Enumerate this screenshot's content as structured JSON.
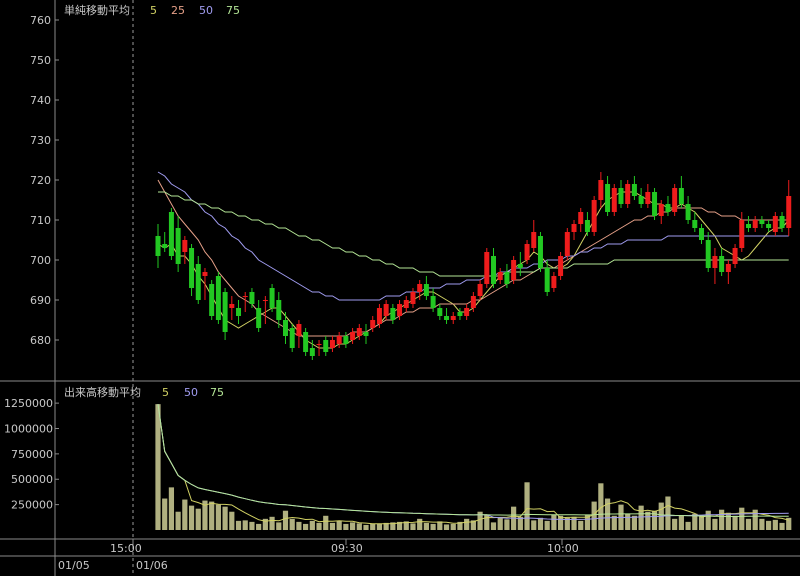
{
  "price_panel": {
    "title": "単純移動平均",
    "ma_labels": [
      {
        "text": "5",
        "color": "#d2d264"
      },
      {
        "text": "25",
        "color": "#e6a088"
      },
      {
        "text": "50",
        "color": "#a09cf0"
      },
      {
        "text": "75",
        "color": "#b4e696"
      }
    ]
  },
  "volume_panel": {
    "title": "出来高移動平均",
    "ma_labels": [
      {
        "text": "5",
        "color": "#d2d264"
      },
      {
        "text": "50",
        "color": "#a09cf0"
      },
      {
        "text": "75",
        "color": "#b4e696"
      }
    ]
  },
  "colors": {
    "up": "#ee1c1c",
    "down": "#22c822",
    "volume": "#b0b080",
    "axis": "#c8c8c8",
    "grid": "#3c3c3c",
    "background": "#000000"
  },
  "chart_data": [
    {
      "type": "candlestick",
      "title": "単純移動平均",
      "ylim": [
        672,
        764
      ],
      "yticks": [
        680,
        690,
        700,
        710,
        720,
        730,
        740,
        750,
        760
      ],
      "ytick_labels": [
        "680",
        "690",
        "700",
        "710",
        "720",
        "730",
        "740",
        "750",
        "760"
      ],
      "x_tick_labels": [
        "15:00",
        "09:30",
        "10:00"
      ],
      "date_labels": [
        "01/05",
        "01/06"
      ],
      "candles_ohlc": [
        [
          706,
          709,
          698,
          701
        ],
        [
          704,
          707,
          702,
          703
        ],
        [
          712,
          713,
          700,
          701
        ],
        [
          708,
          711,
          697,
          699
        ],
        [
          702,
          706,
          699,
          705
        ],
        [
          703,
          704,
          691,
          693
        ],
        [
          699,
          701,
          689,
          690
        ],
        [
          696,
          698,
          690,
          697
        ],
        [
          694,
          695,
          685,
          686
        ],
        [
          696,
          697,
          684,
          685
        ],
        [
          692,
          693,
          680,
          682
        ],
        [
          688,
          691,
          685,
          689
        ],
        [
          688,
          690,
          684,
          686
        ],
        [
          691,
          692,
          687,
          691
        ],
        [
          692,
          693,
          688,
          689
        ],
        [
          688,
          690,
          682,
          683
        ],
        [
          690,
          691,
          684,
          690
        ],
        [
          693,
          694,
          687,
          688
        ],
        [
          690,
          692,
          683,
          685
        ],
        [
          685,
          687,
          679,
          681
        ],
        [
          683,
          684,
          677,
          678
        ],
        [
          681,
          685,
          678,
          684
        ],
        [
          682,
          683,
          676,
          677
        ],
        [
          678,
          680,
          675,
          676
        ],
        [
          679,
          680,
          676,
          679
        ],
        [
          680,
          681,
          676,
          677
        ],
        [
          678,
          681,
          677,
          680
        ],
        [
          679,
          682,
          678,
          681
        ],
        [
          681,
          682,
          678,
          679
        ],
        [
          680,
          683,
          679,
          682
        ],
        [
          681,
          684,
          680,
          683
        ],
        [
          682,
          684,
          679,
          681
        ],
        [
          683,
          686,
          682,
          685
        ],
        [
          684,
          689,
          683,
          688
        ],
        [
          686,
          690,
          685,
          689
        ],
        [
          688,
          689,
          684,
          685
        ],
        [
          686,
          690,
          685,
          689
        ],
        [
          688,
          691,
          687,
          690
        ],
        [
          689,
          693,
          688,
          692
        ],
        [
          692,
          695,
          690,
          694
        ],
        [
          694,
          696,
          690,
          691
        ],
        [
          691,
          693,
          687,
          688
        ],
        [
          688,
          689,
          685,
          686
        ],
        [
          686,
          688,
          684,
          685
        ],
        [
          685,
          687,
          684,
          686
        ],
        [
          687,
          688,
          685,
          686
        ],
        [
          686,
          689,
          685,
          688
        ],
        [
          688,
          692,
          687,
          691
        ],
        [
          691,
          695,
          690,
          694
        ],
        [
          694,
          703,
          693,
          702
        ],
        [
          701,
          703,
          693,
          694
        ],
        [
          695,
          698,
          694,
          697
        ],
        [
          697,
          699,
          693,
          694
        ],
        [
          695,
          701,
          694,
          700
        ],
        [
          699,
          702,
          696,
          698
        ],
        [
          700,
          705,
          699,
          704
        ],
        [
          703,
          710,
          702,
          707
        ],
        [
          706,
          707,
          697,
          698
        ],
        [
          698,
          700,
          691,
          692
        ],
        [
          693,
          697,
          692,
          696
        ],
        [
          696,
          702,
          695,
          701
        ],
        [
          701,
          708,
          700,
          707
        ],
        [
          707,
          710,
          705,
          709
        ],
        [
          709,
          713,
          707,
          712
        ],
        [
          710,
          712,
          706,
          707
        ],
        [
          707,
          716,
          706,
          715
        ],
        [
          715,
          722,
          713,
          720
        ],
        [
          719,
          721,
          711,
          712
        ],
        [
          712,
          719,
          711,
          718
        ],
        [
          718,
          720,
          713,
          714
        ],
        [
          714,
          720,
          713,
          719
        ],
        [
          719,
          721,
          715,
          716
        ],
        [
          716,
          718,
          713,
          714
        ],
        [
          714,
          719,
          713,
          717
        ],
        [
          717,
          718,
          710,
          711
        ],
        [
          711,
          715,
          709,
          714
        ],
        [
          714,
          716,
          711,
          712
        ],
        [
          712,
          719,
          711,
          718
        ],
        [
          718,
          721,
          713,
          714
        ],
        [
          714,
          716,
          709,
          710
        ],
        [
          710,
          712,
          707,
          708
        ],
        [
          708,
          709,
          704,
          705
        ],
        [
          705,
          707,
          697,
          698
        ],
        [
          698,
          703,
          694,
          701
        ],
        [
          701,
          703,
          696,
          697
        ],
        [
          697,
          700,
          694,
          699
        ],
        [
          699,
          704,
          698,
          703
        ],
        [
          703,
          712,
          702,
          710
        ],
        [
          709,
          711,
          707,
          708
        ],
        [
          708,
          711,
          707,
          710
        ],
        [
          710,
          711,
          708,
          709
        ],
        [
          709,
          710,
          707,
          708
        ],
        [
          707,
          712,
          706,
          711
        ],
        [
          711,
          712,
          707,
          708
        ],
        [
          708,
          720,
          706,
          716
        ]
      ],
      "series": [
        {
          "name": "5",
          "color": "#d2d264",
          "values": [
            704,
            703,
            704,
            701,
            701,
            699,
            696,
            694,
            691,
            688,
            685,
            684,
            683,
            684,
            685,
            686,
            687,
            688,
            688,
            686,
            684,
            682,
            680,
            679,
            678,
            678,
            678,
            679,
            679,
            680,
            681,
            682,
            683,
            684,
            686,
            687,
            688,
            689,
            690,
            691,
            692,
            692,
            691,
            690,
            689,
            687,
            687,
            688,
            690,
            692,
            694,
            696,
            697,
            698,
            699,
            700,
            702,
            701,
            699,
            698,
            698,
            699,
            701,
            704,
            707,
            710,
            713,
            715,
            716,
            717,
            717,
            717,
            716,
            715,
            714,
            714,
            713,
            713,
            714,
            713,
            712,
            710,
            708,
            706,
            703,
            702,
            701,
            700,
            701,
            703,
            705,
            707,
            708,
            708,
            710
          ]
        },
        {
          "name": "25",
          "color": "#e6a088",
          "values": [
            720,
            717,
            714,
            711,
            709,
            707,
            705,
            702,
            700,
            697,
            695,
            693,
            691,
            690,
            689,
            687,
            686,
            685,
            684,
            683,
            682,
            681,
            681,
            681,
            681,
            681,
            681,
            681,
            681,
            682,
            682,
            682,
            683,
            684,
            685,
            685,
            686,
            687,
            687,
            688,
            688,
            688,
            689,
            689,
            689,
            689,
            689,
            690,
            690,
            691,
            692,
            693,
            694,
            695,
            695,
            696,
            697,
            698,
            698,
            698,
            699,
            700,
            701,
            702,
            703,
            704,
            705,
            706,
            707,
            708,
            709,
            710,
            710,
            711,
            711,
            712,
            712,
            713,
            713,
            713,
            713,
            713,
            712,
            712,
            711,
            711,
            711,
            710,
            710,
            710,
            710,
            710,
            710,
            710,
            710
          ]
        },
        {
          "name": "50",
          "color": "#a09cf0",
          "values": [
            722,
            721,
            719,
            718,
            717,
            715,
            714,
            712,
            711,
            709,
            708,
            706,
            705,
            703,
            702,
            700,
            699,
            698,
            697,
            696,
            695,
            694,
            693,
            692,
            692,
            691,
            691,
            690,
            690,
            690,
            690,
            690,
            690,
            690,
            691,
            691,
            691,
            692,
            692,
            692,
            693,
            693,
            693,
            694,
            694,
            694,
            695,
            695,
            695,
            696,
            696,
            697,
            697,
            698,
            698,
            698,
            699,
            699,
            700,
            700,
            700,
            701,
            701,
            702,
            702,
            703,
            703,
            704,
            704,
            704,
            705,
            705,
            705,
            705,
            705,
            705,
            706,
            706,
            706,
            706,
            706,
            706,
            706,
            706,
            706,
            706,
            706,
            706,
            706,
            706,
            706,
            706,
            706,
            706,
            706
          ]
        },
        {
          "name": "75",
          "color": "#b4e696",
          "values": [
            717,
            717,
            716,
            716,
            715,
            715,
            714,
            714,
            713,
            713,
            712,
            712,
            711,
            711,
            710,
            710,
            709,
            709,
            708,
            708,
            707,
            706,
            706,
            705,
            705,
            704,
            703,
            703,
            702,
            702,
            701,
            701,
            700,
            700,
            699,
            699,
            698,
            698,
            698,
            697,
            697,
            697,
            696,
            696,
            696,
            696,
            696,
            696,
            696,
            696,
            696,
            696,
            697,
            697,
            697,
            697,
            697,
            698,
            698,
            698,
            698,
            698,
            699,
            699,
            699,
            699,
            699,
            699,
            700,
            700,
            700,
            700,
            700,
            700,
            700,
            700,
            700,
            700,
            700,
            700,
            700,
            700,
            700,
            700,
            700,
            700,
            700,
            700,
            700,
            700,
            700,
            700,
            700,
            700,
            700
          ]
        }
      ]
    },
    {
      "type": "bar",
      "title": "出来高移動平均",
      "ylim": [
        0,
        1330000
      ],
      "yticks": [
        250000,
        500000,
        750000,
        1000000,
        1250000
      ],
      "ytick_labels": [
        "250000",
        "500000",
        "750000",
        "1000000",
        "1250000"
      ],
      "values": [
        1240000,
        310000,
        420000,
        180000,
        300000,
        240000,
        210000,
        290000,
        280000,
        250000,
        230000,
        180000,
        90000,
        95000,
        80000,
        60000,
        110000,
        130000,
        75000,
        190000,
        110000,
        80000,
        60000,
        90000,
        70000,
        140000,
        70000,
        90000,
        60000,
        75000,
        65000,
        50000,
        60000,
        60000,
        70000,
        75000,
        80000,
        85000,
        65000,
        110000,
        70000,
        60000,
        85000,
        55000,
        60000,
        80000,
        110000,
        95000,
        180000,
        150000,
        75000,
        120000,
        105000,
        230000,
        130000,
        470000,
        95000,
        120000,
        90000,
        150000,
        140000,
        120000,
        130000,
        90000,
        150000,
        280000,
        460000,
        310000,
        140000,
        250000,
        160000,
        140000,
        240000,
        180000,
        190000,
        270000,
        330000,
        110000,
        140000,
        80000,
        160000,
        140000,
        190000,
        110000,
        200000,
        170000,
        140000,
        220000,
        110000,
        200000,
        110000,
        90000,
        100000,
        70000,
        120000
      ]
    }
  ]
}
